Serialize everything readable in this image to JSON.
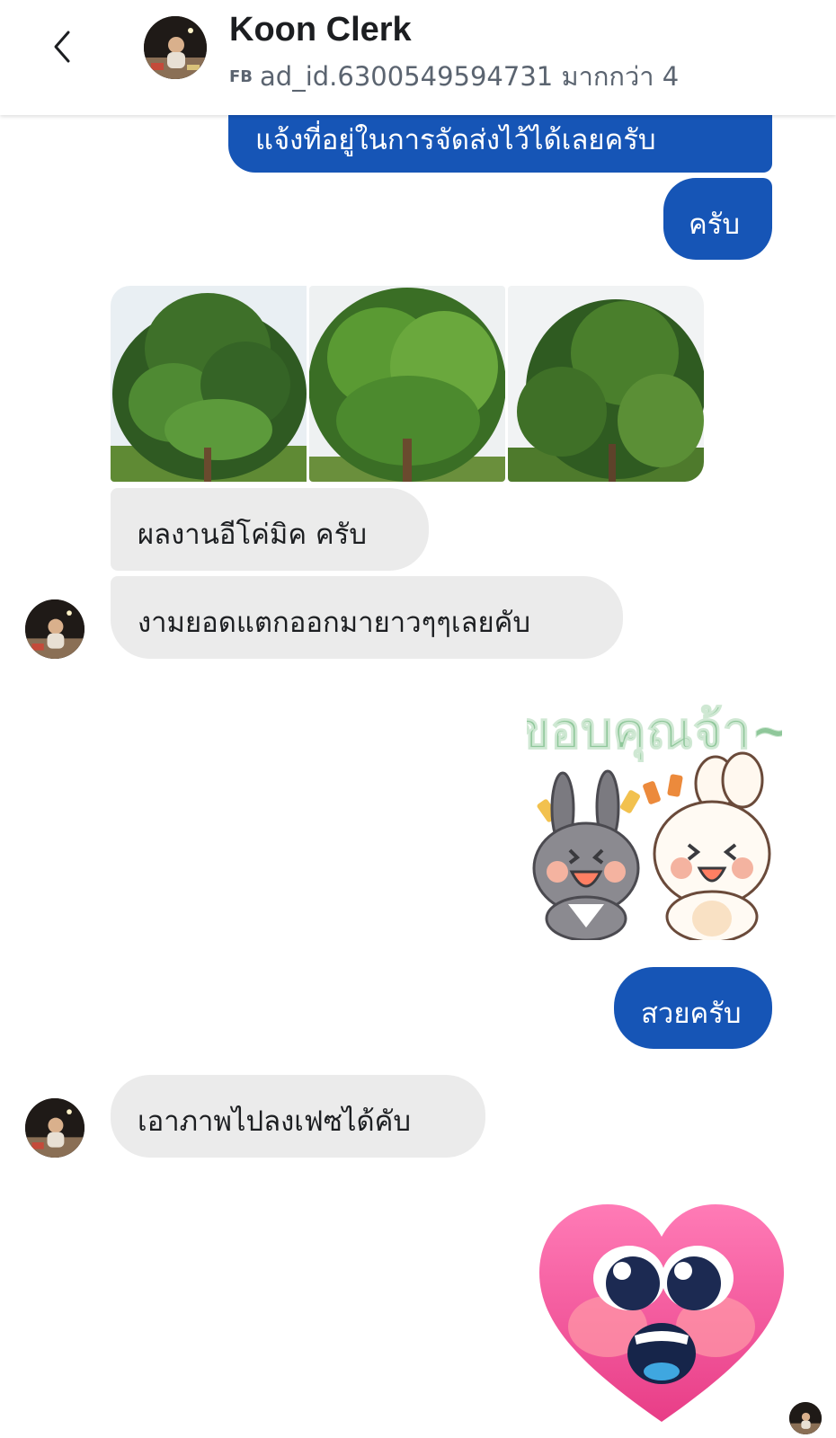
{
  "header": {
    "contact_name": "Koon Clerk",
    "platform_tag": "FB",
    "subtitle": "ad_id.6300549594731 มากกว่า 4",
    "back_icon": "chevron-left-icon"
  },
  "messages": {
    "out_1": "แจ้งที่อยู่ในการจัดส่งไว้ได้เลยครับ",
    "out_2": "ครับ",
    "in_1": "ผลงานอีโค่มิค ครับ",
    "in_2": "งามยอดแตกออกมายาวๆๆเลยคับ",
    "sticker_thanks_text": "ขอบคุณจ้า~",
    "out_3": "สวยครับ",
    "in_3": "เอาภาพไปลงเฟซได้คับ"
  },
  "photos": [
    "durian-tree-photo-1",
    "durian-tree-photo-2",
    "durian-tree-photo-3"
  ],
  "colors": {
    "outgoing_bubble": "#1655b6",
    "incoming_bubble": "#ebebeb",
    "sticker_text": "#8fc79a",
    "heart": "#f2569b"
  }
}
